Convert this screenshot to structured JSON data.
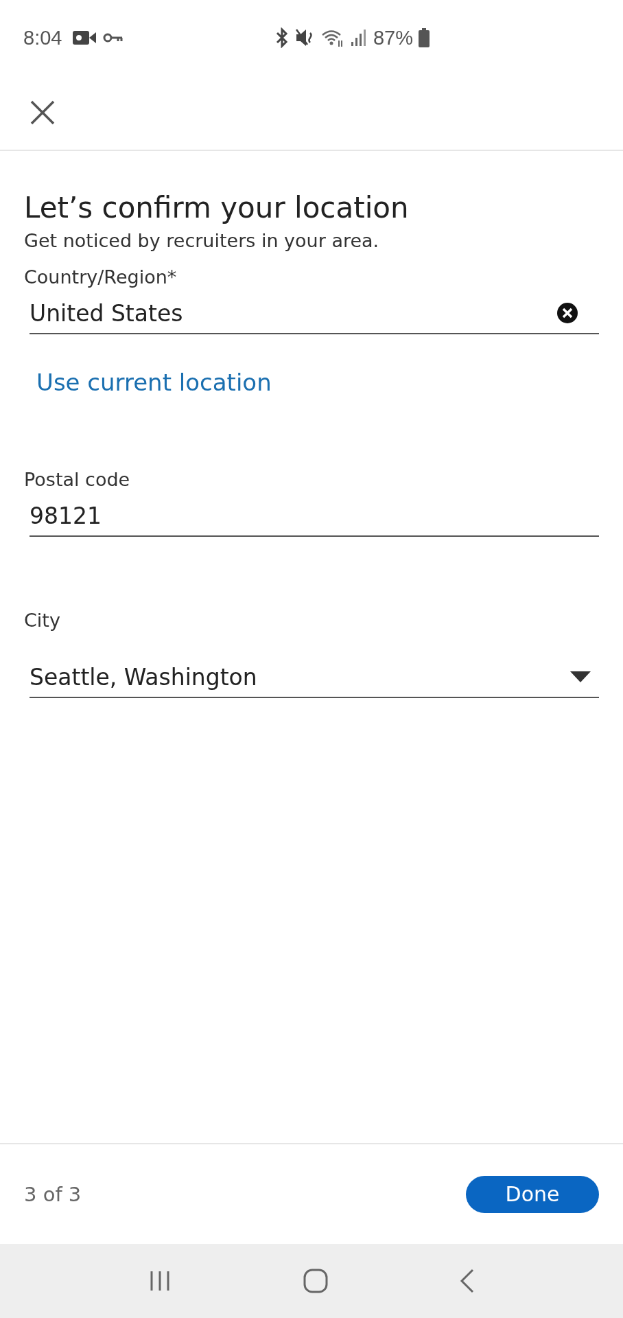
{
  "status_bar": {
    "time": "8:04",
    "battery": "87%"
  },
  "title": "Let’s confirm your location",
  "subtitle": "Get noticed by recruiters in your area.",
  "fields": [
    {
      "kind": "clearable",
      "label": "Country/Region*",
      "value": "United States",
      "link": "Use current location"
    },
    {
      "kind": "plain",
      "label": "Postal code",
      "value": "98121"
    },
    {
      "kind": "dropdown",
      "label": "City",
      "value": "Seattle, Washington"
    }
  ],
  "footer": {
    "step": "3 of 3",
    "button": "Done"
  }
}
